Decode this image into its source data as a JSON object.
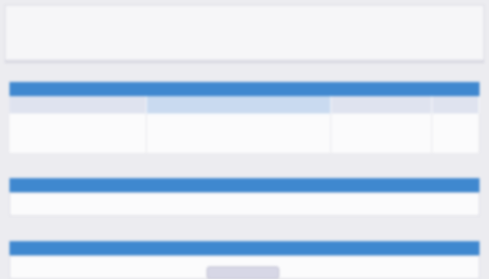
{
  "header": {
    "col1": "",
    "col2": "",
    "col3_link": "",
    "col4": "",
    "col5_link": "",
    "col6": "",
    "col7_link": ""
  },
  "sections": [
    {
      "title": "",
      "columns": [
        "",
        "",
        "",
        ""
      ],
      "row": {
        "c1": "",
        "c2": "",
        "c3": "",
        "c4": ""
      }
    },
    {
      "title": "",
      "text": ""
    },
    {
      "title": "",
      "button": ""
    }
  ],
  "colors": {
    "section_header": "#3f88cf",
    "page_bg": "#ececf0",
    "grid_header": "#dfe3ef"
  }
}
